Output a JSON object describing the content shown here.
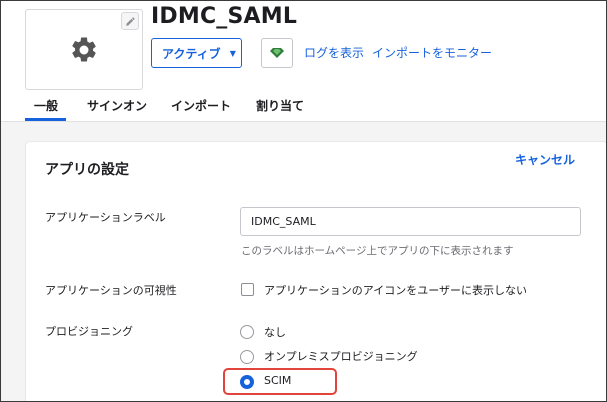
{
  "app": {
    "title": "IDMC_SAML",
    "status": "アクティブ",
    "links": {
      "view_logs": "ログを表示",
      "monitor_imports": "インポートをモニター"
    }
  },
  "tabs": [
    {
      "label": "一般",
      "active": true
    },
    {
      "label": "サインオン",
      "active": false
    },
    {
      "label": "インポート",
      "active": false
    },
    {
      "label": "割り当て",
      "active": false
    }
  ],
  "settings": {
    "title": "アプリの設定",
    "cancel_label": "キャンセル",
    "app_label": {
      "label": "アプリケーションラベル",
      "value": "IDMC_SAML",
      "help": "このラベルはホームページ上でアプリの下に表示されます"
    },
    "visibility": {
      "label": "アプリケーションの可視性",
      "option_label": "アプリケーションのアイコンをユーザーに表示しない",
      "checked": false
    },
    "provisioning": {
      "label": "プロビジョニング",
      "options": [
        {
          "label": "なし",
          "selected": false
        },
        {
          "label": "オンプレミスプロビジョニング",
          "selected": false
        },
        {
          "label": "SCIM",
          "selected": true
        }
      ]
    }
  },
  "colors": {
    "accent": "#1662dd",
    "highlight": "#e0443a",
    "push_icon": "#2e7d3b"
  },
  "icons": {
    "app_logo": "gear-icon",
    "edit": "pencil-icon",
    "push": "push-groups-icon",
    "status_caret": "caret-down-icon"
  }
}
